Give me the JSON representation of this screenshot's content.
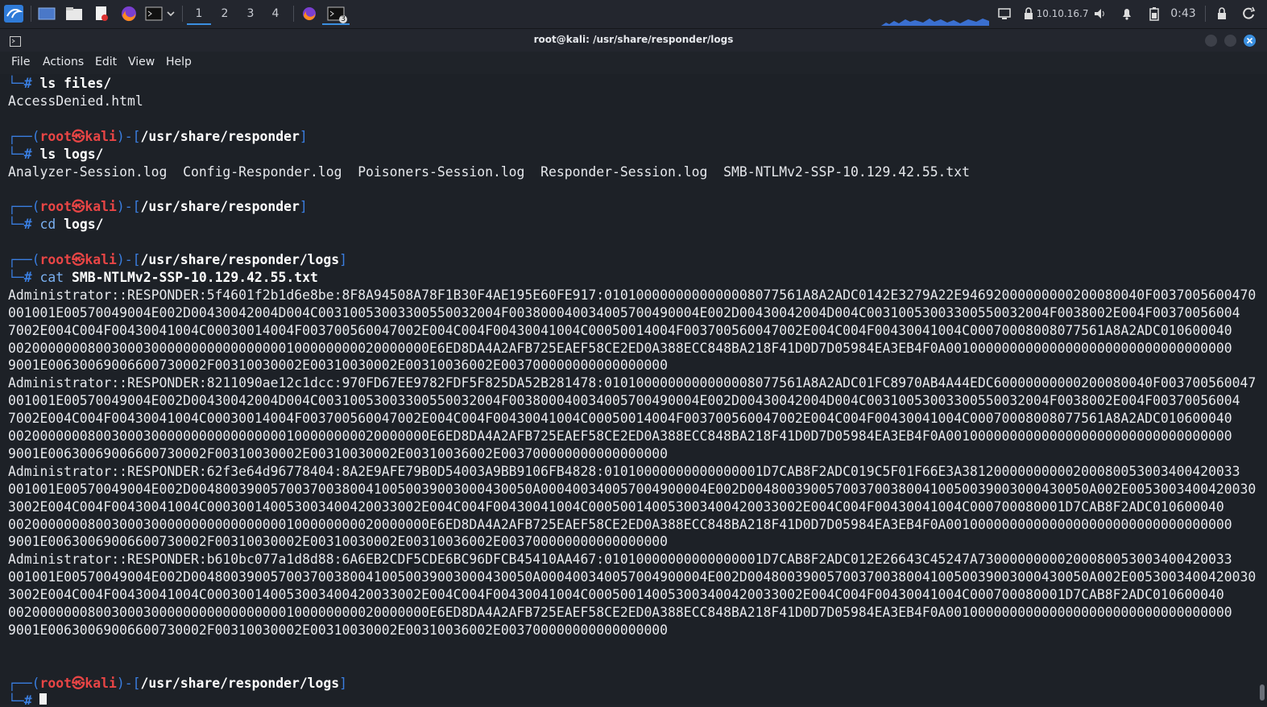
{
  "taskbar": {
    "workspaces": [
      "1",
      "2",
      "3",
      "4"
    ],
    "active_workspace": "1",
    "ip": "10.10.16.7",
    "time": "0:43",
    "terminal_badge": "3",
    "icons": [
      "kali-menu-icon",
      "desktop-icon",
      "file-manager-icon",
      "text-editor-icon",
      "firefox-icon",
      "terminal-icon",
      "chevron-down-icon",
      "firefox-icon",
      "terminal-icon",
      "network-graph",
      "display-icon",
      "vpn-lock-icon",
      "volume-icon",
      "bell-icon",
      "battery-icon",
      "lock-icon",
      "power-icon"
    ]
  },
  "window": {
    "title": "root@kali: /usr/share/responder/logs",
    "menu": [
      "File",
      "Actions",
      "Edit",
      "View",
      "Help"
    ]
  },
  "terminal": {
    "prompt_user": "root",
    "prompt_host": "kali",
    "prompt_symbol": "㉿",
    "lines": [
      {
        "type": "cmd",
        "prefix": "└─# ",
        "cmd": "ls files/"
      },
      {
        "type": "out",
        "text": "AccessDenied.html"
      },
      {
        "type": "blank"
      },
      {
        "type": "prompt",
        "path": "/usr/share/responder"
      },
      {
        "type": "cmd",
        "prefix": "└─# ",
        "cmd": "ls logs/"
      },
      {
        "type": "out",
        "text": "Analyzer-Session.log  Config-Responder.log  Poisoners-Session.log  Responder-Session.log  SMB-NTLMv2-SSP-10.129.42.55.txt"
      },
      {
        "type": "blank"
      },
      {
        "type": "prompt",
        "path": "/usr/share/responder"
      },
      {
        "type": "cmd",
        "prefix": "└─# ",
        "cmd1": "cd ",
        "cmd": "logs/"
      },
      {
        "type": "blank"
      },
      {
        "type": "prompt",
        "path": "/usr/share/responder/logs"
      },
      {
        "type": "cmd",
        "prefix": "└─# ",
        "cmd1": "cat ",
        "cmd": "SMB-NTLMv2-SSP-10.129.42.55.txt"
      },
      {
        "type": "out",
        "text": "Administrator::RESPONDER:5f4601f2b1d6e8be:8F8A94508A78F1B30F4AE195E60FE917:0101000000000000008077561A8A2ADC0142E3279A22E94692000000000200080040F0037005600470"
      },
      {
        "type": "out",
        "text": "001001E00570049004E002D00430042004D004C00310053003300550032004F003800040034005700490004E002D00430042004D004C00310053003300550032004F0038002E004F00370056004"
      },
      {
        "type": "out",
        "text": "7002E004C004F00430041004C00030014004F003700560047002E004C004F00430041004C00050014004F003700560047002E004C004F00430041004C00070008008077561A8A2ADC010600040"
      },
      {
        "type": "out",
        "text": "00200000008003000300000000000000000100000000020000000E6ED8DA4A2AFB725EAEF58CE2ED0A388ECC848BA218F41D0D7D05984EA3EB4F0A001000000000000000000000000000000000"
      },
      {
        "type": "out",
        "text": "9001E00630069006600730002F00310030002E00310030002E00310036002E003700000000000000000"
      },
      {
        "type": "out",
        "text": "Administrator::RESPONDER:8211090ae12c1dcc:970FD67EE9782FDF5F825DA52B281478:0101000000000000008077561A8A2ADC01FC8970AB4A44EDC60000000000200080040F0037005600470"
      },
      {
        "type": "out",
        "text": "001001E00570049004E002D00430042004D004C00310053003300550032004F003800040034005700490004E002D00430042004D004C00310053003300550032004F0038002E004F00370056004"
      },
      {
        "type": "out",
        "text": "7002E004C004F00430041004C00030014004F003700560047002E004C004F00430041004C00050014004F003700560047002E004C004F00430041004C00070008008077561A8A2ADC010600040"
      },
      {
        "type": "out",
        "text": "00200000008003000300000000000000000100000000020000000E6ED8DA4A2AFB725EAEF58CE2ED0A388ECC848BA218F41D0D7D05984EA3EB4F0A001000000000000000000000000000000000"
      },
      {
        "type": "out",
        "text": "9001E00630069006600730002F00310030002E00310030002E00310036002E003700000000000000000"
      },
      {
        "type": "out",
        "text": "Administrator::RESPONDER:62f3e64d96778404:8A2E9AFE79B0D54003A9BB9106FB4828:01010000000000000001D7CAB8F2ADC019C5F01F66E3A38120000000000200080053003400420033"
      },
      {
        "type": "out",
        "text": "001001E00570049004E002D0048003900570037003800410050039003000430050A000400340057004900004E002D0048003900570037003800410050039003000430050A002E00530034004200303"
      },
      {
        "type": "out",
        "text": "3002E004C004F00430041004C000300140053003400420033002E004C004F00430041004C000500140053003400420033002E004C004F00430041004C000700080001D7CAB8F2ADC010600040"
      },
      {
        "type": "out",
        "text": "00200000008003000300000000000000000100000000020000000E6ED8DA4A2AFB725EAEF58CE2ED0A388ECC848BA218F41D0D7D05984EA3EB4F0A001000000000000000000000000000000000"
      },
      {
        "type": "out",
        "text": "9001E00630069006600730002F00310030002E00310030002E00310036002E003700000000000000000"
      },
      {
        "type": "out",
        "text": "Administrator::RESPONDER:b610bc077a1d8d88:6A6EB2CDF5CDE6BC96DFCB45410AA467:01010000000000000001D7CAB8F2ADC012E26643C45247A73000000000200080053003400420033"
      },
      {
        "type": "out",
        "text": "001001E00570049004E002D0048003900570037003800410050039003000430050A000400340057004900004E002D0048003900570037003800410050039003000430050A002E00530034004200303"
      },
      {
        "type": "out",
        "text": "3002E004C004F00430041004C000300140053003400420033002E004C004F00430041004C000500140053003400420033002E004C004F00430041004C000700080001D7CAB8F2ADC010600040"
      },
      {
        "type": "out",
        "text": "00200000008003000300000000000000000100000000020000000E6ED8DA4A2AFB725EAEF58CE2ED0A388ECC848BA218F41D0D7D05984EA3EB4F0A001000000000000000000000000000000000"
      },
      {
        "type": "out",
        "text": "9001E00630069006600730002F00310030002E00310030002E00310036002E003700000000000000000"
      },
      {
        "type": "blank"
      },
      {
        "type": "blank"
      },
      {
        "type": "prompt",
        "path": "/usr/share/responder/logs"
      },
      {
        "type": "cursor",
        "prefix": "└─# "
      }
    ]
  }
}
